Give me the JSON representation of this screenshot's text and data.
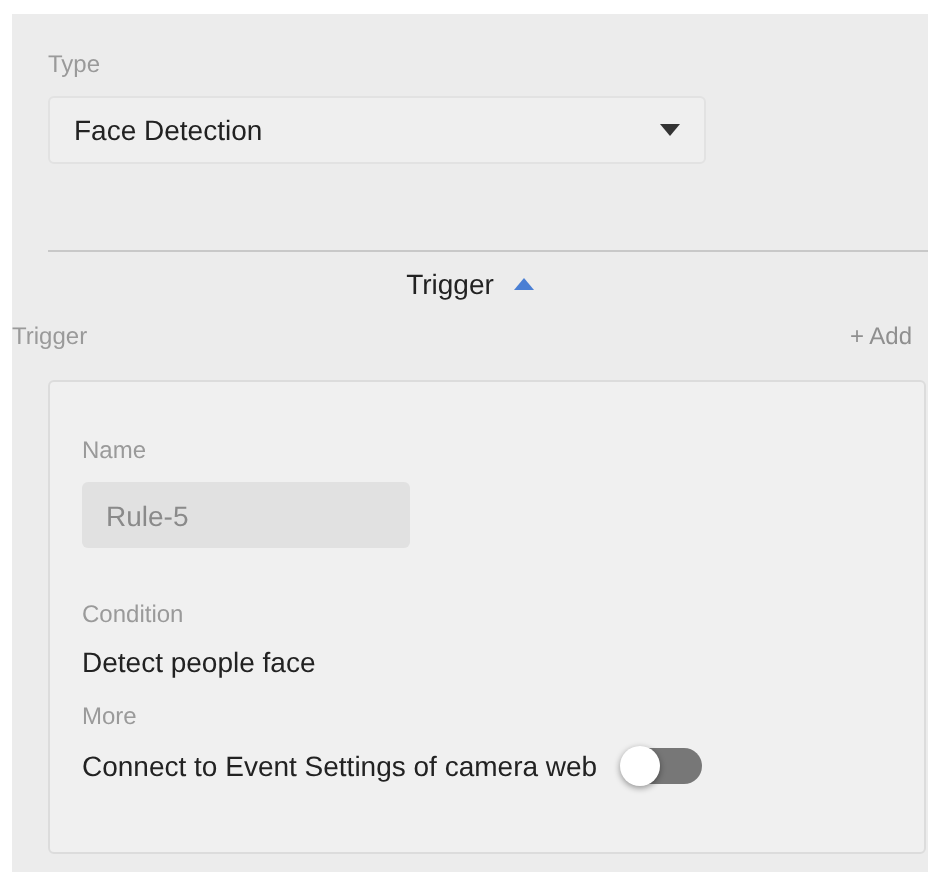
{
  "type_field": {
    "label": "Type",
    "value": "Face Detection"
  },
  "section": {
    "title": "Trigger",
    "expanded": true
  },
  "trigger": {
    "label": "Trigger",
    "add": "+ Add"
  },
  "rule": {
    "name_label": "Name",
    "name_placeholder": "Rule-5",
    "name_disabled": true,
    "condition_label": "Condition",
    "condition": "Detect people face",
    "more_label": "More",
    "connect_label": "Connect to Event Settings of camera web",
    "connect_on": false
  }
}
